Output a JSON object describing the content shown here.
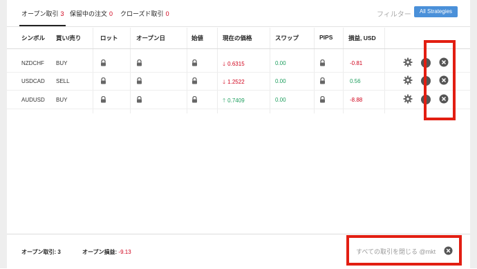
{
  "tabs": [
    {
      "label": "オープン取引",
      "count": "3"
    },
    {
      "label": "保留中の注文",
      "count": "0"
    },
    {
      "label": "クローズド取引",
      "count": "0"
    }
  ],
  "filter": {
    "label": "フィルター",
    "button": "All Strategies"
  },
  "columns": [
    "シンボル",
    "買い/売り",
    "ロット",
    "オープン日",
    "始値",
    "現在の価格",
    "スワップ",
    "PIPS",
    "損益, USD"
  ],
  "rows": [
    {
      "symbol": "NZDCHF",
      "side": "BUY",
      "price": "0.6315",
      "direction": "down",
      "swap": "0.00",
      "pnl": "-0.81",
      "pnl_sign": "neg"
    },
    {
      "symbol": "USDCAD",
      "side": "SELL",
      "price": "1.2522",
      "direction": "down",
      "swap": "0.00",
      "pnl": "0.56",
      "pnl_sign": "pos"
    },
    {
      "symbol": "AUDUSD",
      "side": "BUY",
      "price": "0.7409",
      "direction": "up",
      "swap": "0.00",
      "pnl": "-8.88",
      "pnl_sign": "neg"
    }
  ],
  "footer": {
    "open_trades_label": "オープン取引:",
    "open_trades_value": "3",
    "open_pnl_label": "オープン損益:",
    "open_pnl_value": "-9.13",
    "close_all_label": "すべての取引を閉じる @mkt"
  },
  "colors": {
    "accent": "#4a90d9",
    "negative": "#d0021b",
    "positive": "#1e9e5e",
    "highlight": "#e21e12"
  }
}
